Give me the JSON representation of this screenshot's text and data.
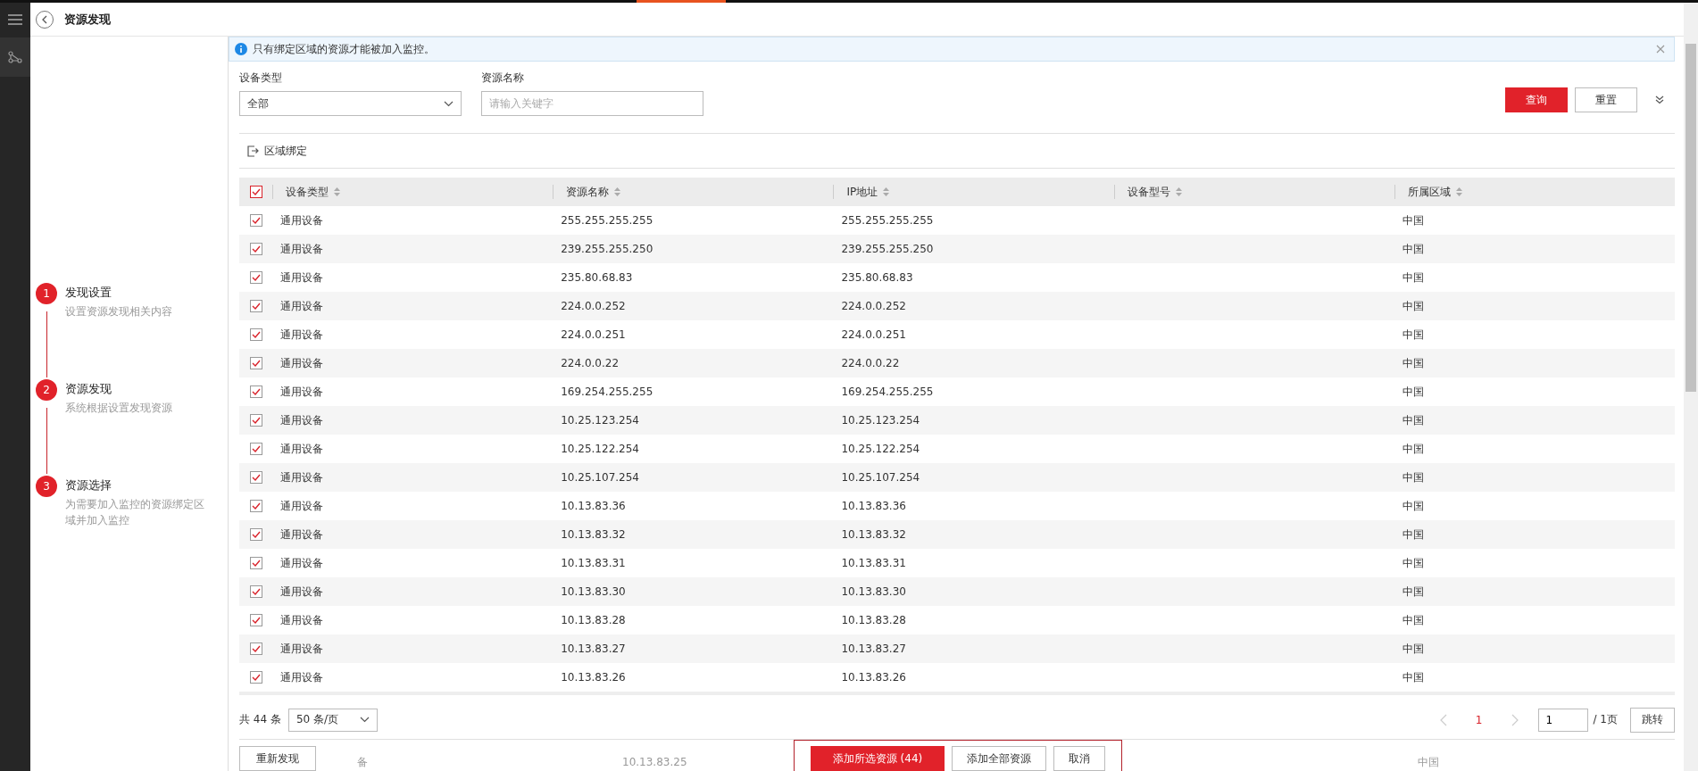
{
  "header": {
    "title": "资源发现"
  },
  "steps": [
    {
      "number": "1",
      "title": "发现设置",
      "description": "设置资源发现相关内容"
    },
    {
      "number": "2",
      "title": "资源发现",
      "description": "系统根据设置发现资源"
    },
    {
      "number": "3",
      "title": "资源选择",
      "description": "为需要加入监控的资源绑定区域并加入监控"
    }
  ],
  "notice": {
    "text": "只有绑定区域的资源才能被加入监控。"
  },
  "filters": [
    {
      "kind": "select",
      "label": "设备类型",
      "value": "全部"
    },
    {
      "kind": "input",
      "label": "资源名称",
      "placeholder": "请输入关键字"
    }
  ],
  "actions": [
    {
      "label": "查询",
      "kind": "primary"
    },
    {
      "label": "重置",
      "kind": "default"
    }
  ],
  "toolbar": {
    "bind_button": "区域绑定"
  },
  "table": {
    "all_checked": true,
    "columns": [
      "设备类型",
      "资源名称",
      "IP地址",
      "设备型号",
      "所属区域"
    ],
    "rows": [
      {
        "checked": true,
        "type": "通用设备",
        "name": "255.255.255.255",
        "ip": "255.255.255.255",
        "region": "中国"
      },
      {
        "checked": true,
        "type": "通用设备",
        "name": "239.255.255.250",
        "ip": "239.255.255.250",
        "region": "中国"
      },
      {
        "checked": true,
        "type": "通用设备",
        "name": "235.80.68.83",
        "ip": "235.80.68.83",
        "region": "中国"
      },
      {
        "checked": true,
        "type": "通用设备",
        "name": "224.0.0.252",
        "ip": "224.0.0.252",
        "region": "中国"
      },
      {
        "checked": true,
        "type": "通用设备",
        "name": "224.0.0.251",
        "ip": "224.0.0.251",
        "region": "中国"
      },
      {
        "checked": true,
        "type": "通用设备",
        "name": "224.0.0.22",
        "ip": "224.0.0.22",
        "region": "中国"
      },
      {
        "checked": true,
        "type": "通用设备",
        "name": "169.254.255.255",
        "ip": "169.254.255.255",
        "region": "中国"
      },
      {
        "checked": true,
        "type": "通用设备",
        "name": "10.25.123.254",
        "ip": "10.25.123.254",
        "region": "中国"
      },
      {
        "checked": true,
        "type": "通用设备",
        "name": "10.25.122.254",
        "ip": "10.25.122.254",
        "region": "中国"
      },
      {
        "checked": true,
        "type": "通用设备",
        "name": "10.25.107.254",
        "ip": "10.25.107.254",
        "region": "中国"
      },
      {
        "checked": true,
        "type": "通用设备",
        "name": "10.13.83.36",
        "ip": "10.13.83.36",
        "region": "中国"
      },
      {
        "checked": true,
        "type": "通用设备",
        "name": "10.13.83.32",
        "ip": "10.13.83.32",
        "region": "中国"
      },
      {
        "checked": true,
        "type": "通用设备",
        "name": "10.13.83.31",
        "ip": "10.13.83.31",
        "region": "中国"
      },
      {
        "checked": true,
        "type": "通用设备",
        "name": "10.13.83.30",
        "ip": "10.13.83.30",
        "region": "中国"
      },
      {
        "checked": true,
        "type": "通用设备",
        "name": "10.13.83.28",
        "ip": "10.13.83.28",
        "region": "中国"
      },
      {
        "checked": true,
        "type": "通用设备",
        "name": "10.13.83.27",
        "ip": "10.13.83.27",
        "region": "中国"
      },
      {
        "checked": true,
        "type": "通用设备",
        "name": "10.13.83.26",
        "ip": "10.13.83.26",
        "region": "中国"
      }
    ]
  },
  "pagination": {
    "total": "共 44 条",
    "page_size": "50 条/页",
    "pages": [
      {
        "label": "1",
        "selected": true
      }
    ],
    "jump_value": "1",
    "page_count": "/ 1页",
    "jump_button": "跳转"
  },
  "hidden_row": {
    "type": "备",
    "name": "10.13.83.25",
    "region": "中国"
  },
  "footer": {
    "rediscover": "重新发现",
    "highlighted": true,
    "buttons": [
      {
        "label": "添加所选资源 (44)",
        "kind": "primary"
      },
      {
        "label": "添加全部资源",
        "kind": "default"
      },
      {
        "label": "取消",
        "kind": "default"
      }
    ]
  }
}
